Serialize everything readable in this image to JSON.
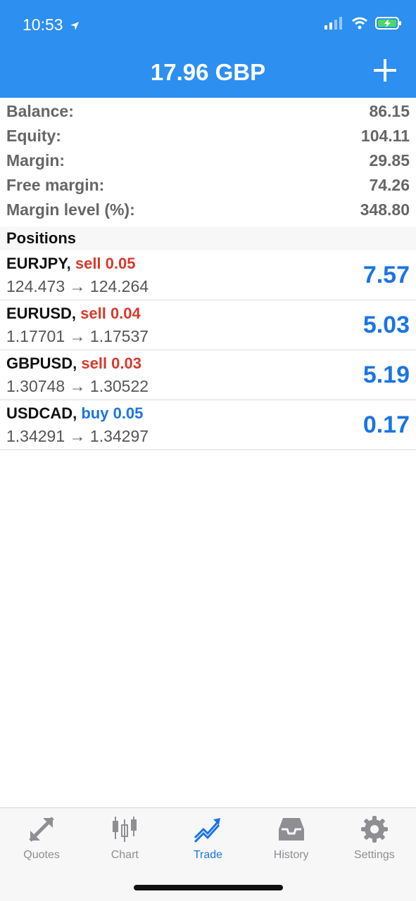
{
  "status": {
    "time": "10:53"
  },
  "header": {
    "title": "17.96 GBP"
  },
  "summary": [
    {
      "label": "Balance:",
      "value": "86.15"
    },
    {
      "label": "Equity:",
      "value": "104.11"
    },
    {
      "label": "Margin:",
      "value": "29.85"
    },
    {
      "label": "Free margin:",
      "value": "74.26"
    },
    {
      "label": "Margin level (%):",
      "value": "348.80"
    }
  ],
  "positions_header": "Positions",
  "positions": [
    {
      "symbol": "EURJPY,",
      "side": "sell 0.05",
      "open": "124.473",
      "arrow": "→",
      "current": "124.264",
      "profit": "7.57"
    },
    {
      "symbol": "EURUSD,",
      "side": "sell 0.04",
      "open": "1.17701",
      "arrow": "→",
      "current": "1.17537",
      "profit": "5.03"
    },
    {
      "symbol": "GBPUSD,",
      "side": "sell 0.03",
      "open": "1.30748",
      "arrow": "→",
      "current": "1.30522",
      "profit": "5.19"
    },
    {
      "symbol": "USDCAD,",
      "side": "buy 0.05",
      "open": "1.34291",
      "arrow": "→",
      "current": "1.34297",
      "profit": "0.17"
    }
  ],
  "tabs": [
    {
      "label": "Quotes",
      "icon": "quotes-icon"
    },
    {
      "label": "Chart",
      "icon": "chart-icon"
    },
    {
      "label": "Trade",
      "icon": "trade-icon",
      "active": true
    },
    {
      "label": "History",
      "icon": "history-icon"
    },
    {
      "label": "Settings",
      "icon": "gear-icon"
    }
  ],
  "colors": {
    "accent": "#2d8ff0",
    "sell": "#d8392b",
    "buy": "#1b74e4",
    "profit": "#1b74e4"
  }
}
